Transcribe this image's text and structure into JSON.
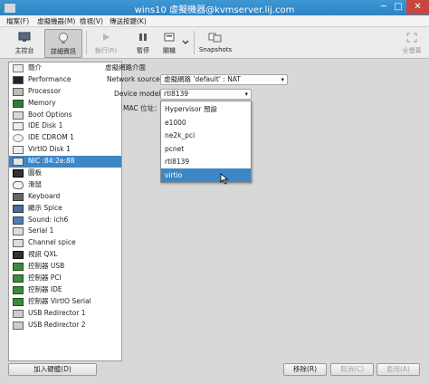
{
  "window": {
    "title": "wins10 虛擬機器@kvmserver.lij.com",
    "minimize": "─",
    "maximize": "□",
    "close": "✕"
  },
  "menu": [
    "檔案(F)",
    "虛擬機器(M)",
    "檢視(V)",
    "傳送按鍵(K)"
  ],
  "toolbar": {
    "console": "主控台",
    "details": "詳細資訊",
    "run": "執行(R)",
    "pause": "暫停",
    "shutdown": "關機",
    "snapshots": "Snapshots",
    "fullscreen": "全螢幕"
  },
  "sidebar": {
    "items": [
      {
        "label": "簡介",
        "icon": "overview-icon"
      },
      {
        "label": "Performance",
        "icon": "performance-icon"
      },
      {
        "label": "Processor",
        "icon": "processor-icon"
      },
      {
        "label": "Memory",
        "icon": "memory-icon"
      },
      {
        "label": "Boot Options",
        "icon": "boot-options-icon"
      },
      {
        "label": "IDE Disk 1",
        "icon": "disk-icon"
      },
      {
        "label": "IDE CDROM 1",
        "icon": "cdrom-icon"
      },
      {
        "label": "VirtIO Disk 1",
        "icon": "disk-icon"
      },
      {
        "label": "NIC :84:2e:88",
        "icon": "nic-icon",
        "selected": true
      },
      {
        "label": "圖板",
        "icon": "tablet-icon"
      },
      {
        "label": "滑鼠",
        "icon": "mouse-icon"
      },
      {
        "label": "Keyboard",
        "icon": "keyboard-icon"
      },
      {
        "label": "顯示 Spice",
        "icon": "display-icon"
      },
      {
        "label": "Sound: ich6",
        "icon": "sound-icon"
      },
      {
        "label": "Serial 1",
        "icon": "serial-icon"
      },
      {
        "label": "Channel spice",
        "icon": "channel-icon"
      },
      {
        "label": "視訊 QXL",
        "icon": "video-icon"
      },
      {
        "label": "控制器 USB",
        "icon": "controller-icon"
      },
      {
        "label": "控制器 PCI",
        "icon": "controller-icon"
      },
      {
        "label": "控制器 IDE",
        "icon": "controller-icon"
      },
      {
        "label": "控制器 VirtIO Serial",
        "icon": "controller-icon"
      },
      {
        "label": "USB Redirector 1",
        "icon": "usb-redirector-icon"
      },
      {
        "label": "USB Redirector 2",
        "icon": "usb-redirector-icon"
      }
    ],
    "add_button": "加入硬體(D)"
  },
  "nic": {
    "section_title": "虛擬網路介面",
    "network_source_label": "Network source:",
    "network_source_value": "虛擬網路 'default' : NAT",
    "device_model_label": "Device model:",
    "device_model_value": "rtl8139",
    "mac_label": "MAC 位址：",
    "model_options": [
      {
        "label": "Hypervisor 預設"
      },
      {
        "label": "e1000"
      },
      {
        "label": "ne2k_pci"
      },
      {
        "label": "pcnet"
      },
      {
        "label": "rtl8139"
      },
      {
        "label": "virtio",
        "highlighted": true
      }
    ]
  },
  "buttons": {
    "remove": "移除(R)",
    "cancel": "取消(C)",
    "apply": "套用(A)"
  },
  "colors": {
    "accent": "#3d87c7",
    "titlebar": "#2e83c3",
    "close": "#c9463d"
  }
}
